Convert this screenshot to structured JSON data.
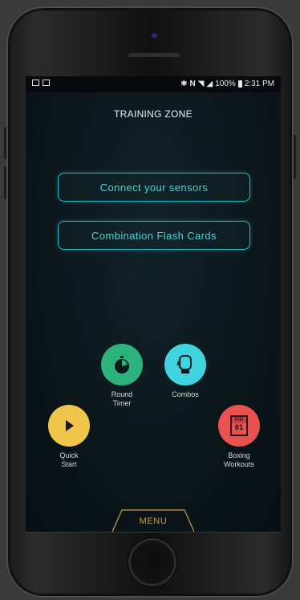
{
  "status_bar": {
    "battery": "100%",
    "time": "2:31 PM"
  },
  "header": {
    "title": "TRAINING ZONE"
  },
  "buttons": {
    "connect_sensors": "Connect your sensors",
    "flash_cards": "Combination Flash Cards"
  },
  "actions": {
    "round_timer": {
      "line1": "Round",
      "line2": "Timer",
      "color": "#2bb37b"
    },
    "combos": {
      "line1": "Combos",
      "color": "#3fd4e0"
    },
    "quick_start": {
      "line1": "Quick",
      "line2": "Start",
      "color": "#f0c64a"
    },
    "boxing_workouts": {
      "line1": "Boxing",
      "line2": "Workouts",
      "color": "#e8524f",
      "badge_top": "RND",
      "badge_num": "01"
    }
  },
  "menu": {
    "label": "MENU",
    "accent_color": "#d39a3c"
  },
  "accent": "#26b9c4"
}
